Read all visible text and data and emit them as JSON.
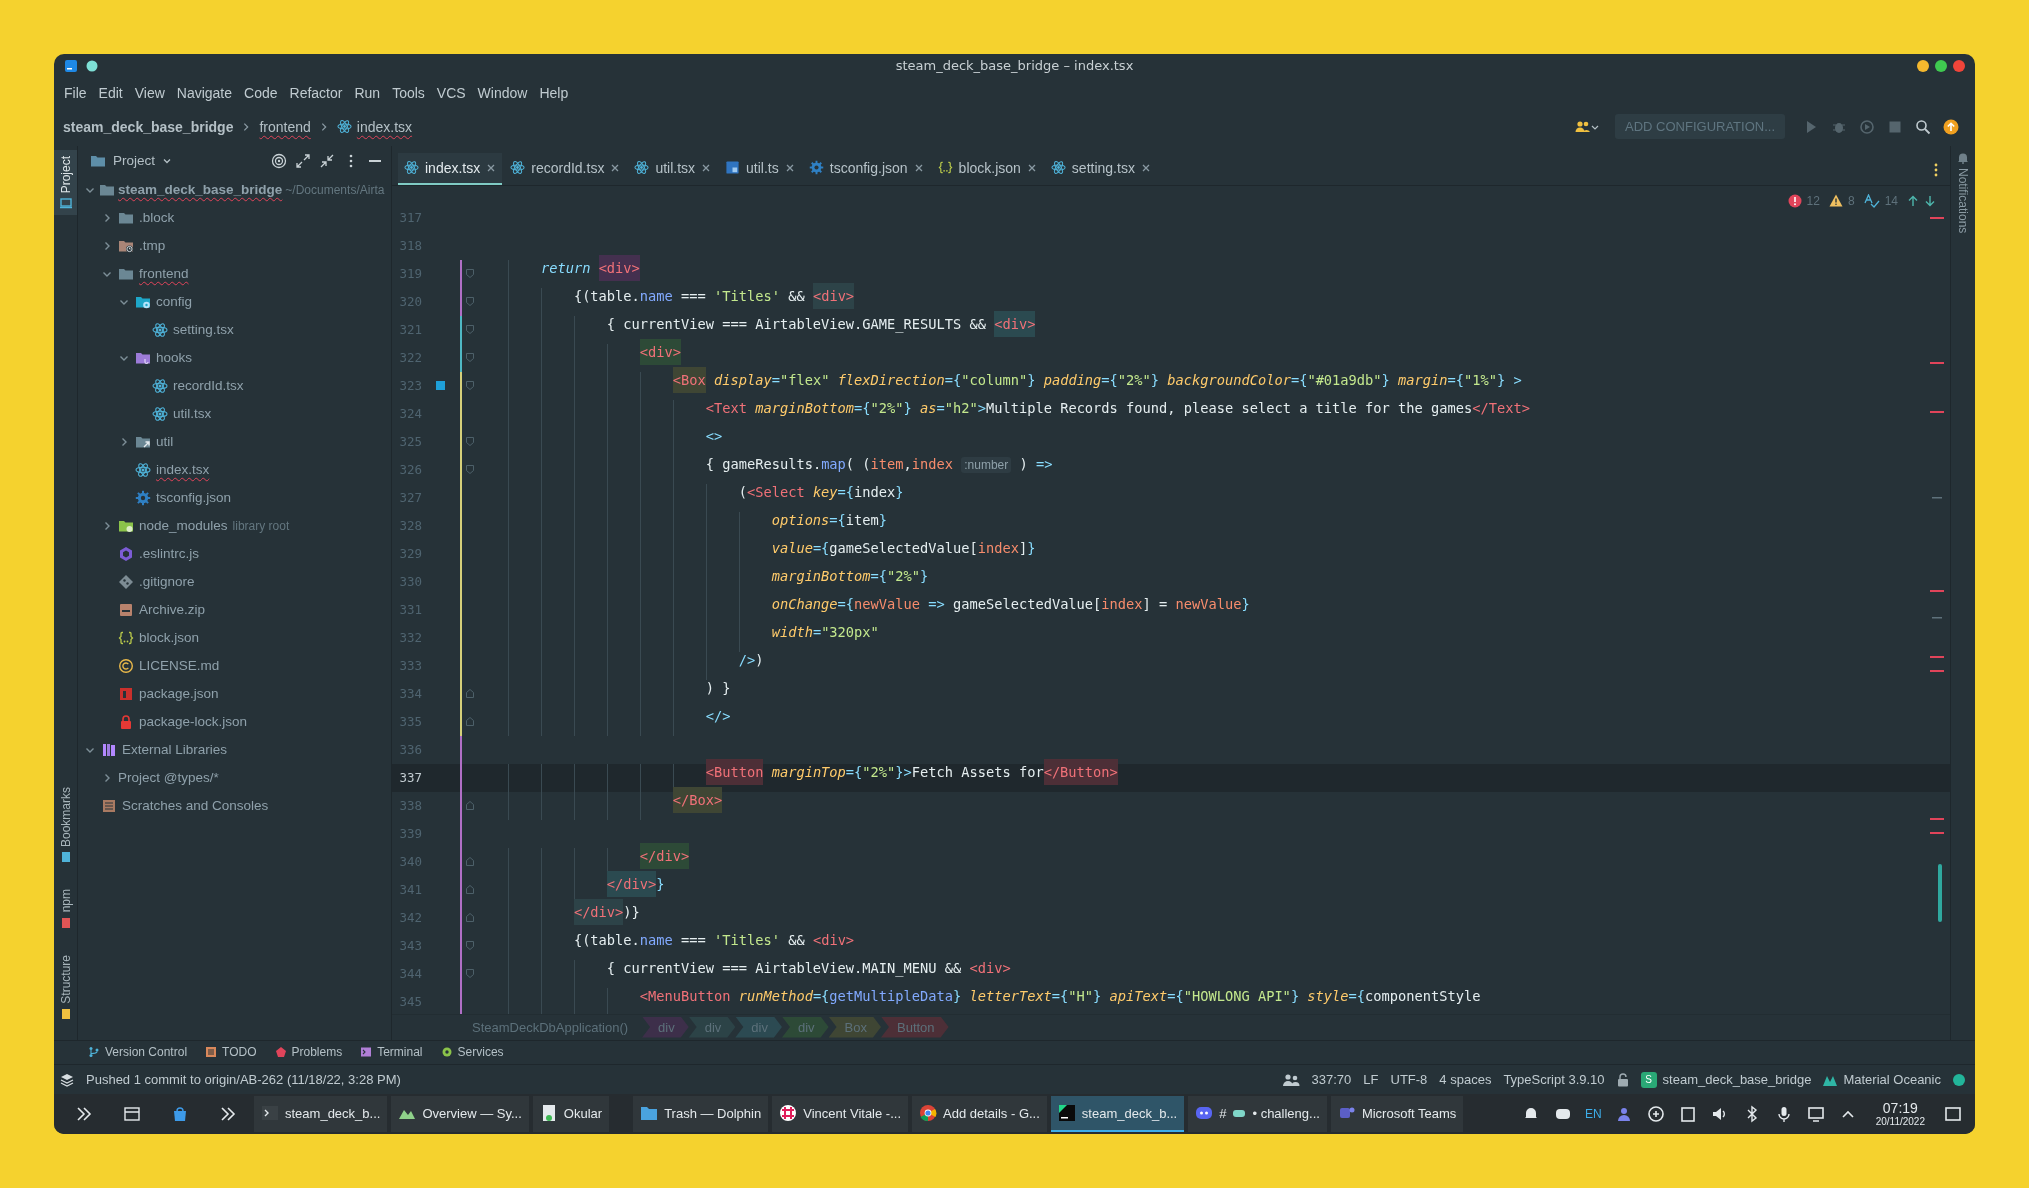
{
  "window": {
    "title": "steam_deck_base_bridge – index.tsx"
  },
  "menu": [
    "File",
    "Edit",
    "View",
    "Navigate",
    "Code",
    "Refactor",
    "Run",
    "Tools",
    "VCS",
    "Window",
    "Help"
  ],
  "navigation": {
    "breadcrumbs": [
      {
        "text": "steam_deck_base_bridge",
        "kind": "project",
        "error": false
      },
      {
        "text": "frontend",
        "kind": "folder",
        "error": true
      },
      {
        "text": "index.tsx",
        "kind": "file",
        "error": true
      }
    ],
    "run_configuration": "ADD CONFIGURATION..."
  },
  "left_strip": {
    "top": [
      {
        "label": "Project",
        "selected": true
      }
    ],
    "bottom": [
      {
        "label": "Bookmarks",
        "selected": false
      },
      {
        "label": "npm",
        "selected": false
      },
      {
        "label": "Structure",
        "selected": false
      }
    ]
  },
  "project_panel": {
    "title": "Project",
    "tree": [
      {
        "label": "steam_deck_base_bridge",
        "hint": "~/Documents/Airta",
        "kind": "folder",
        "error": true,
        "expanded": true,
        "children": [
          {
            "label": ".block",
            "kind": "folder",
            "error": false,
            "expanded": false
          },
          {
            "label": ".tmp",
            "kind": "folder-tmp",
            "error": false,
            "expanded": false
          },
          {
            "label": "frontend",
            "kind": "folder",
            "error": true,
            "expanded": true,
            "children": [
              {
                "label": "config",
                "kind": "folder-config",
                "error": false,
                "expanded": true,
                "children": [
                  {
                    "label": "setting.tsx",
                    "kind": "react",
                    "error": false
                  }
                ]
              },
              {
                "label": "hooks",
                "kind": "folder-hooks",
                "error": false,
                "expanded": true,
                "children": [
                  {
                    "label": "recordId.tsx",
                    "kind": "react",
                    "error": false
                  },
                  {
                    "label": "util.tsx",
                    "kind": "react",
                    "error": false
                  }
                ]
              },
              {
                "label": "util",
                "kind": "folder-link",
                "error": false,
                "expanded": false
              },
              {
                "label": "index.tsx",
                "kind": "react",
                "error": true
              },
              {
                "label": "tsconfig.json",
                "kind": "tsconfig",
                "error": false
              }
            ]
          },
          {
            "label": "node_modules",
            "hint": "library root",
            "kind": "folder-lib",
            "error": false,
            "expanded": false
          },
          {
            "label": ".eslintrc.js",
            "kind": "eslint",
            "error": false
          },
          {
            "label": ".gitignore",
            "kind": "git",
            "error": false
          },
          {
            "label": "Archive.zip",
            "kind": "zip",
            "error": false
          },
          {
            "label": "block.json",
            "kind": "json",
            "error": false
          },
          {
            "label": "LICENSE.md",
            "kind": "license",
            "error": false
          },
          {
            "label": "package.json",
            "kind": "npm",
            "error": false
          },
          {
            "label": "package-lock.json",
            "kind": "lock",
            "error": false
          }
        ]
      },
      {
        "label": "External Libraries",
        "kind": "library",
        "error": false,
        "expanded": true,
        "children": [
          {
            "label": "Project @types/*",
            "kind": "group",
            "error": false,
            "expanded": false
          }
        ]
      },
      {
        "label": "Scratches and Consoles",
        "kind": "scratch",
        "error": false
      }
    ]
  },
  "editor": {
    "tabs": [
      {
        "label": "index.tsx",
        "kind": "react",
        "selected": true
      },
      {
        "label": "recordId.tsx",
        "kind": "react",
        "selected": false
      },
      {
        "label": "util.tsx",
        "kind": "react",
        "selected": false
      },
      {
        "label": "util.ts",
        "kind": "ts",
        "selected": false
      },
      {
        "label": "tsconfig.json",
        "kind": "tsconfig",
        "selected": false
      },
      {
        "label": "block.json",
        "kind": "json",
        "selected": false
      },
      {
        "label": "setting.tsx",
        "kind": "react",
        "selected": false
      }
    ],
    "inspections": {
      "errors": "12",
      "warnings": "8",
      "typos": "14"
    },
    "lines": [
      {
        "number": "317",
        "kind": "plain",
        "current": false,
        "bookmark": false
      },
      {
        "number": "318",
        "kind": "plain",
        "current": false,
        "bookmark": false
      },
      {
        "number": "319",
        "kind": "fold-start",
        "current": false,
        "bookmark": false,
        "tokens": [
          {
            "kind": "kw",
            "text": "        return "
          },
          {
            "kind": "tag",
            "text": "<div>",
            "color": "#44304f"
          }
        ]
      },
      {
        "number": "320",
        "kind": "fold-start",
        "current": false,
        "bookmark": false,
        "tokens": [
          {
            "kind": "plain",
            "text": "            {(table."
          },
          {
            "kind": "prop",
            "text": "name"
          },
          {
            "kind": "plain",
            "text": " === "
          },
          {
            "kind": "str",
            "text": "'Titles'"
          },
          {
            "kind": "plain",
            "text": " && "
          },
          {
            "kind": "tag",
            "text": "<div>",
            "color": "#2d4348"
          }
        ]
      },
      {
        "number": "321",
        "kind": "fold-start",
        "current": false,
        "bookmark": false,
        "tokens": [
          {
            "kind": "plain",
            "text": "                { currentView === AirtableView.GAME_RESULTS && "
          },
          {
            "kind": "tag",
            "text": "<div>",
            "color": "#2b4a50"
          }
        ]
      },
      {
        "number": "322",
        "kind": "fold-start",
        "current": false,
        "bookmark": false,
        "tokens": [
          {
            "kind": "tag",
            "text": "                    <div>",
            "color": "#2d4a37"
          }
        ]
      },
      {
        "number": "323",
        "kind": "fold-start",
        "current": false,
        "bookmark": true,
        "tokens": [
          {
            "kind": "tag",
            "text": "                        <Box",
            "color": "#3f4634"
          },
          {
            "kind": "attr",
            "text": " display"
          },
          {
            "kind": "punct",
            "text": "="
          },
          {
            "kind": "str",
            "text": "\"flex\""
          },
          {
            "kind": "attr",
            "text": " flexDirection"
          },
          {
            "kind": "punct",
            "text": "={"
          },
          {
            "kind": "str",
            "text": "\"column\""
          },
          {
            "kind": "punct",
            "text": "} "
          },
          {
            "kind": "attr",
            "text": "padding"
          },
          {
            "kind": "punct",
            "text": "={"
          },
          {
            "kind": "str",
            "text": "\"2%\""
          },
          {
            "kind": "punct",
            "text": "} "
          },
          {
            "kind": "attr",
            "text": "backgroundColor"
          },
          {
            "kind": "punct",
            "text": "={"
          },
          {
            "kind": "str",
            "text": "\"#01a9db\""
          },
          {
            "kind": "punct",
            "text": "} "
          },
          {
            "kind": "attr",
            "text": "margin"
          },
          {
            "kind": "punct",
            "text": "={"
          },
          {
            "kind": "str",
            "text": "\"1%\""
          },
          {
            "kind": "punct",
            "text": "} >"
          }
        ]
      },
      {
        "number": "324",
        "kind": "plain",
        "current": false,
        "bookmark": false,
        "tokens": [
          {
            "kind": "tag",
            "text": "                            <Text"
          },
          {
            "kind": "attr",
            "text": " marginBottom"
          },
          {
            "kind": "punct",
            "text": "={"
          },
          {
            "kind": "str",
            "text": "\"2%\""
          },
          {
            "kind": "punct",
            "text": "} "
          },
          {
            "kind": "attr",
            "text": "as"
          },
          {
            "kind": "punct",
            "text": "="
          },
          {
            "kind": "str",
            "text": "\"h2\""
          },
          {
            "kind": "punct",
            "text": ">"
          },
          {
            "kind": "plain",
            "text": "Multiple Records found, please select a title for the games"
          },
          {
            "kind": "tag",
            "text": "</Text>"
          }
        ]
      },
      {
        "number": "325",
        "kind": "fold-start",
        "current": false,
        "bookmark": false,
        "tokens": [
          {
            "kind": "punct",
            "text": "                            <>"
          }
        ]
      },
      {
        "number": "326",
        "kind": "fold-start",
        "current": false,
        "bookmark": false,
        "tokens": [
          {
            "kind": "plain",
            "text": "                            { gameResults."
          },
          {
            "kind": "prop",
            "text": "map"
          },
          {
            "kind": "plain",
            "text": "( ("
          },
          {
            "kind": "param",
            "text": "item"
          },
          {
            "kind": "plain",
            "text": ","
          },
          {
            "kind": "param",
            "text": "index "
          },
          {
            "kind": "hint",
            "text": ":number"
          },
          {
            "kind": "plain",
            "text": " ) "
          },
          {
            "kind": "punct",
            "text": "=>"
          }
        ]
      },
      {
        "number": "327",
        "kind": "plain",
        "current": false,
        "bookmark": false,
        "tokens": [
          {
            "kind": "plain",
            "text": "                                ("
          },
          {
            "kind": "tag",
            "text": "<Select"
          },
          {
            "kind": "attr",
            "text": " key"
          },
          {
            "kind": "punct",
            "text": "={"
          },
          {
            "kind": "plain",
            "text": "index"
          },
          {
            "kind": "punct",
            "text": "}"
          }
        ]
      },
      {
        "number": "328",
        "kind": "plain",
        "current": false,
        "bookmark": false,
        "tokens": [
          {
            "kind": "attr",
            "text": "                                    options"
          },
          {
            "kind": "punct",
            "text": "={"
          },
          {
            "kind": "plain",
            "text": "item"
          },
          {
            "kind": "punct",
            "text": "}"
          }
        ]
      },
      {
        "number": "329",
        "kind": "plain",
        "current": false,
        "bookmark": false,
        "tokens": [
          {
            "kind": "attr",
            "text": "                                    value"
          },
          {
            "kind": "punct",
            "text": "={"
          },
          {
            "kind": "plain",
            "text": "gameSelectedValue["
          },
          {
            "kind": "param",
            "text": "index"
          },
          {
            "kind": "plain",
            "text": "]"
          },
          {
            "kind": "punct",
            "text": "}"
          }
        ]
      },
      {
        "number": "330",
        "kind": "plain",
        "current": false,
        "bookmark": false,
        "tokens": [
          {
            "kind": "attr",
            "text": "                                    marginBottom"
          },
          {
            "kind": "punct",
            "text": "={"
          },
          {
            "kind": "str",
            "text": "\"2%\""
          },
          {
            "kind": "punct",
            "text": "}"
          }
        ]
      },
      {
        "number": "331",
        "kind": "plain",
        "current": false,
        "bookmark": false,
        "tokens": [
          {
            "kind": "attr",
            "text": "                                    onChange"
          },
          {
            "kind": "punct",
            "text": "={"
          },
          {
            "kind": "param",
            "text": "newValue"
          },
          {
            "kind": "punct",
            "text": " =>"
          },
          {
            "kind": "plain",
            "text": " gameSelectedValue["
          },
          {
            "kind": "param",
            "text": "index"
          },
          {
            "kind": "plain",
            "text": "] = "
          },
          {
            "kind": "param",
            "text": "newValue"
          },
          {
            "kind": "punct",
            "text": "}"
          }
        ]
      },
      {
        "number": "332",
        "kind": "plain",
        "current": false,
        "bookmark": false,
        "tokens": [
          {
            "kind": "attr",
            "text": "                                    width"
          },
          {
            "kind": "punct",
            "text": "="
          },
          {
            "kind": "str",
            "text": "\"320px\""
          }
        ]
      },
      {
        "number": "333",
        "kind": "plain",
        "current": false,
        "bookmark": false,
        "tokens": [
          {
            "kind": "punct",
            "text": "                                />"
          },
          {
            "kind": "plain",
            "text": ")"
          }
        ]
      },
      {
        "number": "334",
        "kind": "fold-end",
        "current": false,
        "bookmark": false,
        "tokens": [
          {
            "kind": "plain",
            "text": "                            ) }"
          }
        ]
      },
      {
        "number": "335",
        "kind": "fold-end",
        "current": false,
        "bookmark": false,
        "tokens": [
          {
            "kind": "punct",
            "text": "                            </>"
          }
        ]
      },
      {
        "number": "336",
        "kind": "plain",
        "current": false,
        "bookmark": false
      },
      {
        "number": "337",
        "kind": "plain",
        "current": true,
        "bookmark": false,
        "tokens": [
          {
            "kind": "tag",
            "text": "                            <Button",
            "color": "#4d2f37"
          },
          {
            "kind": "attr",
            "text": " marginTop"
          },
          {
            "kind": "punct",
            "text": "={"
          },
          {
            "kind": "str",
            "text": "\"2%\""
          },
          {
            "kind": "punct",
            "text": "}>"
          },
          {
            "kind": "plain",
            "text": "Fetch Assets for"
          },
          {
            "kind": "tag",
            "text": "</Button>",
            "color": "#4d2f37"
          }
        ]
      },
      {
        "number": "338",
        "kind": "fold-end",
        "current": false,
        "bookmark": false,
        "tokens": [
          {
            "kind": "tag",
            "text": "                        </Box>",
            "color": "#3f4634"
          }
        ]
      },
      {
        "number": "339",
        "kind": "plain",
        "current": false,
        "bookmark": false
      },
      {
        "number": "340",
        "kind": "fold-end",
        "current": false,
        "bookmark": false,
        "tokens": [
          {
            "kind": "tag",
            "text": "                    </div>",
            "color": "#2d4a37"
          }
        ]
      },
      {
        "number": "341",
        "kind": "fold-end",
        "current": false,
        "bookmark": false,
        "tokens": [
          {
            "kind": "tag",
            "text": "                </div>",
            "color": "#2b4a50"
          },
          {
            "kind": "punct",
            "text": "}"
          }
        ]
      },
      {
        "number": "342",
        "kind": "fold-end",
        "current": false,
        "bookmark": false,
        "tokens": [
          {
            "kind": "tag",
            "text": "            </div>",
            "color": "#2d4348"
          },
          {
            "kind": "plain",
            "text": ")}"
          }
        ]
      },
      {
        "number": "343",
        "kind": "fold-start",
        "current": false,
        "bookmark": false,
        "tokens": [
          {
            "kind": "plain",
            "text": "            {(table."
          },
          {
            "kind": "prop",
            "text": "name"
          },
          {
            "kind": "plain",
            "text": " === "
          },
          {
            "kind": "str",
            "text": "'Titles'"
          },
          {
            "kind": "plain",
            "text": " && "
          },
          {
            "kind": "tag",
            "text": "<div>"
          }
        ]
      },
      {
        "number": "344",
        "kind": "fold-start",
        "current": false,
        "bookmark": false,
        "tokens": [
          {
            "kind": "plain",
            "text": "                { currentView === AirtableView.MAIN_MENU && "
          },
          {
            "kind": "tag",
            "text": "<div>"
          }
        ]
      },
      {
        "number": "345",
        "kind": "plain",
        "current": false,
        "bookmark": false,
        "tokens": [
          {
            "kind": "tag",
            "text": "                    <MenuButton"
          },
          {
            "kind": "attr",
            "text": " runMethod"
          },
          {
            "kind": "punct",
            "text": "={"
          },
          {
            "kind": "prop",
            "text": "getMultipleData"
          },
          {
            "kind": "punct",
            "text": "} "
          },
          {
            "kind": "attr",
            "text": "letterText"
          },
          {
            "kind": "punct",
            "text": "={"
          },
          {
            "kind": "str",
            "text": "\"H\""
          },
          {
            "kind": "punct",
            "text": "} "
          },
          {
            "kind": "attr",
            "text": "apiText"
          },
          {
            "kind": "punct",
            "text": "={"
          },
          {
            "kind": "str",
            "text": "\"HOWLONG API\""
          },
          {
            "kind": "punct",
            "text": "} "
          },
          {
            "kind": "attr",
            "text": "style"
          },
          {
            "kind": "punct",
            "text": "={"
          },
          {
            "kind": "plain",
            "text": "componentStyle"
          }
        ]
      }
    ],
    "breadcrumbs": [
      {
        "text": "SteamDeckDbApplication()",
        "color": "#263238"
      },
      {
        "text": "div",
        "color": "#3d2f4a"
      },
      {
        "text": "div",
        "color": "#2c4347"
      },
      {
        "text": "div",
        "color": "#2c4a52"
      },
      {
        "text": "div",
        "color": "#2d4a37"
      },
      {
        "text": "Box",
        "color": "#3f4634"
      },
      {
        "text": "Button",
        "color": "#4d2f37"
      }
    ]
  },
  "right_strip": {
    "label": "Notifications"
  },
  "tool_windows": [
    {
      "label": "Version Control",
      "kind": "branch"
    },
    {
      "label": "TODO",
      "kind": "todo"
    },
    {
      "label": "Problems",
      "kind": "problems"
    },
    {
      "label": "Terminal",
      "kind": "terminal"
    },
    {
      "label": "Services",
      "kind": "services"
    }
  ],
  "status_bar": {
    "message": "Pushed 1 commit to origin/AB-262 (11/18/22, 3:28 PM)",
    "position": "337:70",
    "line_separator": "LF",
    "encoding": "UTF-8",
    "indent": "4 spaces",
    "language": "TypeScript 3.9.10",
    "project_badge": "S",
    "project": "steam_deck_base_bridge",
    "theme": "Material Oceanic"
  },
  "taskbar": {
    "tasks": [
      {
        "label": "steam_deck_b...",
        "kind": "terminal",
        "selected": false
      },
      {
        "label": "Overview — Sy...",
        "kind": "monitor",
        "selected": false
      },
      {
        "label": "Okular",
        "kind": "okular",
        "selected": false
      },
      {
        "label": "Trash — Dolphin",
        "kind": "folder",
        "selected": false
      },
      {
        "label": "Vincent Vitale -...",
        "kind": "slack",
        "selected": false
      },
      {
        "label": "Add details - G...",
        "kind": "chrome",
        "selected": false
      },
      {
        "label": "steam_deck_b...",
        "kind": "ide",
        "selected": true
      },
      {
        "label": "• challeng...",
        "prefix": "#",
        "kind": "discord",
        "selected": false
      },
      {
        "label": "Microsoft Teams",
        "kind": "teams",
        "selected": false
      }
    ],
    "keyboard_layout": "EN",
    "time": "07:19",
    "date": "20/11/2022"
  }
}
